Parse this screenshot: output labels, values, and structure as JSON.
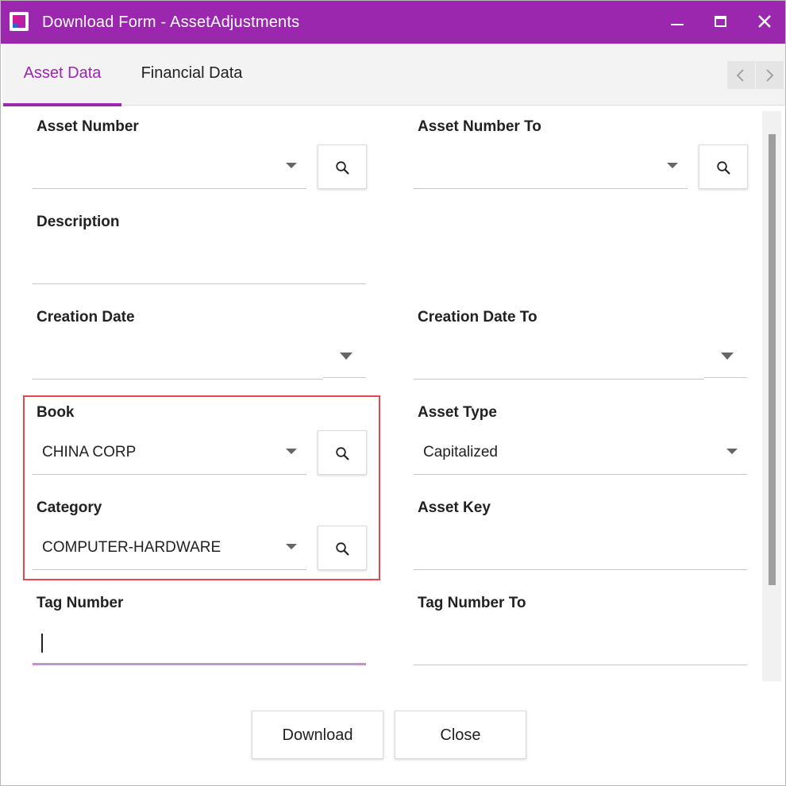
{
  "window": {
    "title": "Download Form - AssetAdjustments",
    "accent": "#9b27af"
  },
  "tabs": [
    {
      "label": "Asset Data",
      "active": true
    },
    {
      "label": "Financial Data",
      "active": false
    }
  ],
  "fields": {
    "asset_number": {
      "label": "Asset Number",
      "value": ""
    },
    "asset_number_to": {
      "label": "Asset Number To",
      "value": ""
    },
    "description": {
      "label": "Description",
      "value": ""
    },
    "creation_date": {
      "label": "Creation Date",
      "value": ""
    },
    "creation_date_to": {
      "label": "Creation Date To",
      "value": ""
    },
    "book": {
      "label": "Book",
      "value": "CHINA CORP"
    },
    "asset_type": {
      "label": "Asset Type",
      "value": "Capitalized"
    },
    "category": {
      "label": "Category",
      "value": "COMPUTER-HARDWARE"
    },
    "asset_key": {
      "label": "Asset Key",
      "value": ""
    },
    "tag_number": {
      "label": "Tag Number",
      "value": ""
    },
    "tag_number_to": {
      "label": "Tag Number To",
      "value": ""
    }
  },
  "buttons": {
    "download": "Download",
    "close": "Close"
  },
  "icons": {
    "search": "magnifier-icon",
    "dropdown": "caret-down-icon"
  },
  "highlight_color": "#e8474d"
}
